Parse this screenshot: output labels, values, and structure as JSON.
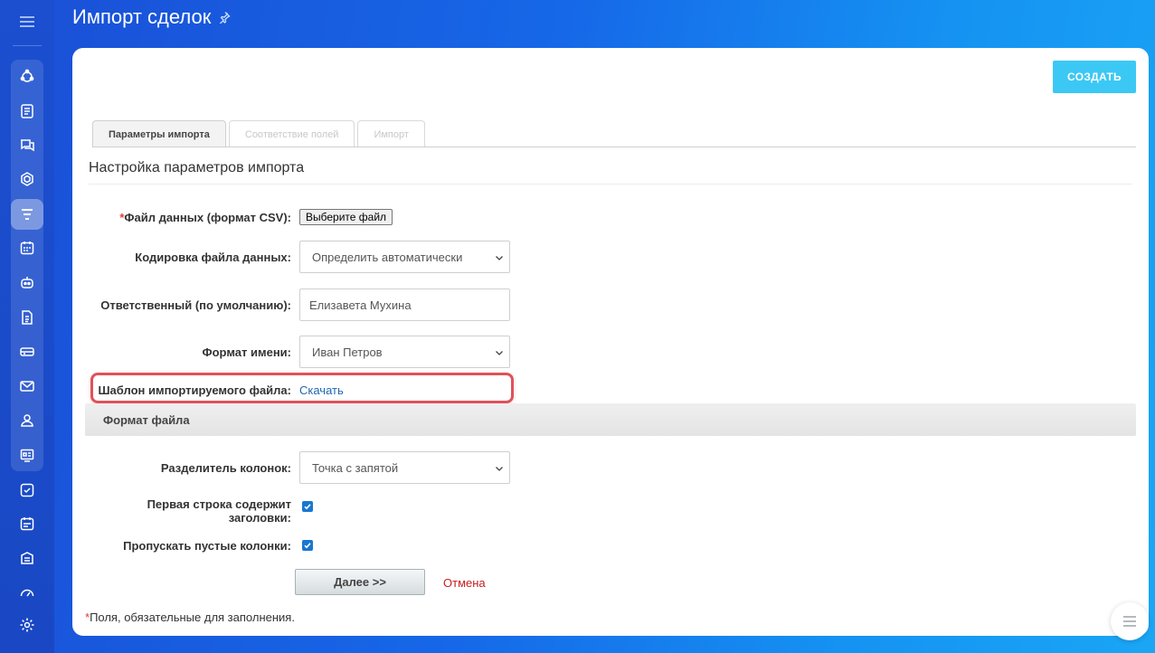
{
  "page": {
    "title": "Импорт сделок",
    "create_button": "СОЗДАТЬ"
  },
  "sidebar": {
    "icons": [
      "menu-icon",
      "sitemap-icon",
      "news-icon",
      "chat-icon",
      "hexagon-icon",
      "funnel-icon",
      "calendar-icon",
      "robot-icon",
      "document-icon",
      "drive-icon",
      "mail-icon",
      "contacts-icon",
      "presentation-icon",
      "tasks-icon",
      "schedule-icon",
      "store-icon",
      "speedometer-icon",
      "settings-icon"
    ],
    "active": "funnel-icon"
  },
  "tabs": [
    {
      "label": "Параметры импорта",
      "active": true
    },
    {
      "label": "Соответствие полей",
      "active": false
    },
    {
      "label": "Импорт",
      "active": false
    }
  ],
  "section": {
    "title": "Настройка параметров импорта"
  },
  "form": {
    "file": {
      "required_mark": "*",
      "label": "Файл данных (формат CSV):",
      "button": "Выберите файл"
    },
    "encoding": {
      "label": "Кодировка файла данных:",
      "value": "Определить автоматически"
    },
    "responsible": {
      "label": "Ответственный (по умолчанию):",
      "value": "Елизавета Мухина"
    },
    "name_format": {
      "label": "Формат имени:",
      "value": "Иван Петров"
    },
    "template": {
      "label": "Шаблон импортируемого файла:",
      "link": "Скачать"
    }
  },
  "file_format": {
    "title": "Формат файла",
    "separator": {
      "label": "Разделитель колонок:",
      "value": "Точка с запятой"
    },
    "first_row_header": {
      "label_line1": "Первая строка содержит",
      "label_line2": "заголовки:",
      "checked": true
    },
    "skip_empty": {
      "label": "Пропускать пустые колонки:",
      "checked": true
    }
  },
  "actions": {
    "next": "Далее >>",
    "cancel": "Отмена"
  },
  "footnote": {
    "mark": "*",
    "text": "Поля, обязательные для заполнения."
  },
  "colors": {
    "accent": "#3bc8f5",
    "highlight": "#e0515a",
    "link": "#2067b0",
    "cancel": "#c51d1d",
    "checkbox": "#1976d2"
  }
}
